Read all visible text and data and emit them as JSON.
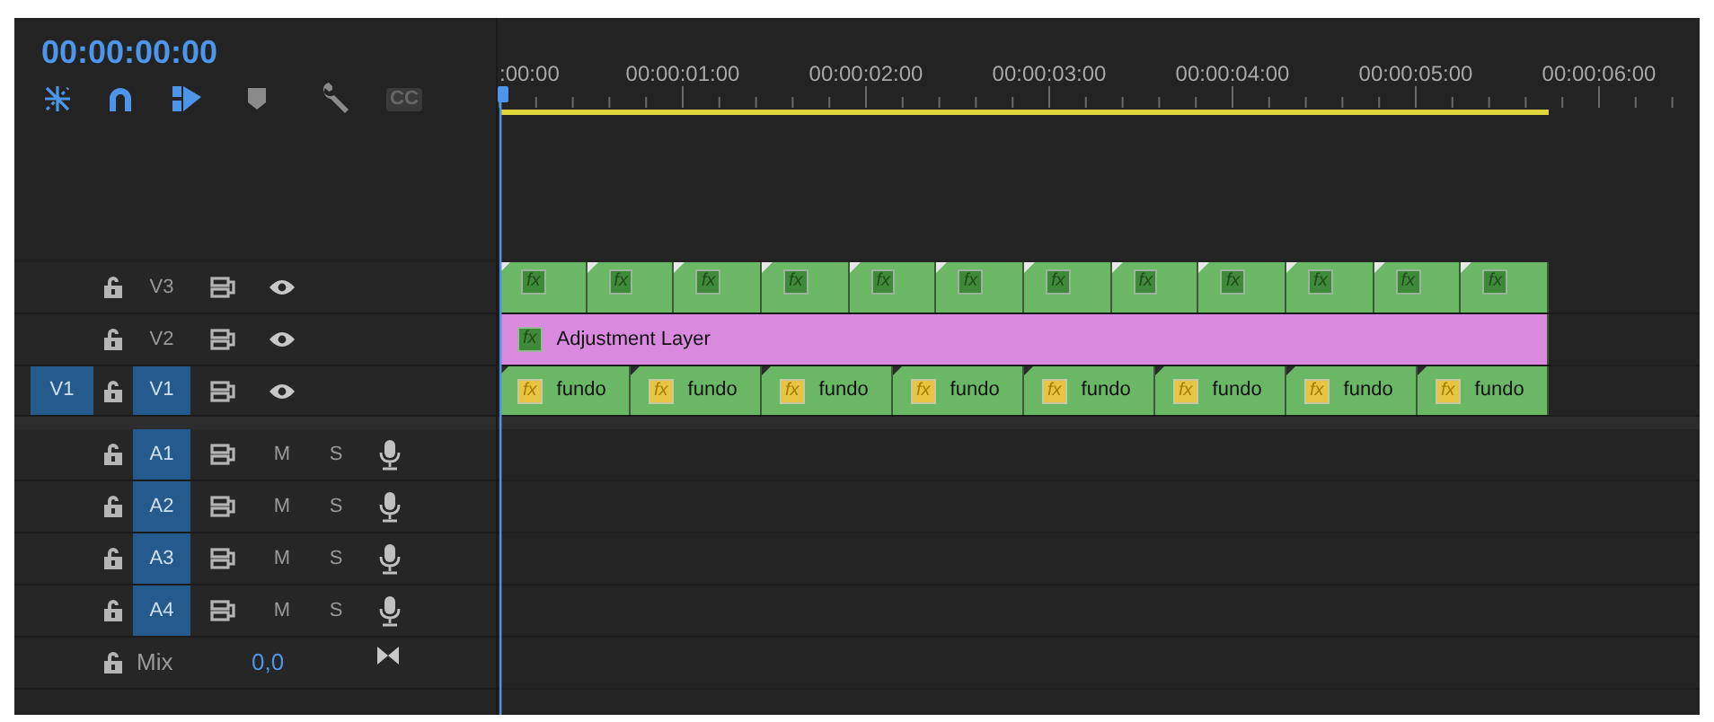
{
  "timecode": "00:00:00:00",
  "toolbar": [
    {
      "kind": "nest",
      "on": true
    },
    {
      "kind": "snap",
      "on": true
    },
    {
      "kind": "linked",
      "on": true
    },
    {
      "kind": "marker",
      "on": false
    },
    {
      "kind": "settings",
      "on": false
    },
    {
      "kind": "captions",
      "on": false,
      "label": "CC"
    }
  ],
  "ruler": {
    "labels": [
      ":00:00",
      "00:00:01:00",
      "00:00:02:00",
      "00:00:03:00",
      "00:00:04:00",
      "00:00:05:00",
      "00:00:06:00"
    ]
  },
  "video_tracks": [
    {
      "name": "V3",
      "targeted": false,
      "clips": [
        {
          "color": "#6ab866",
          "badge": {
            "text": "fx",
            "kind": "green"
          }
        },
        {
          "color": "#6ab866",
          "badge": {
            "text": "fx",
            "kind": "green"
          }
        },
        {
          "color": "#6ab866",
          "badge": {
            "text": "fx",
            "kind": "green"
          }
        },
        {
          "color": "#6ab866",
          "badge": {
            "text": "fx",
            "kind": "green"
          }
        },
        {
          "color": "#6ab866",
          "badge": {
            "text": "fx",
            "kind": "green"
          }
        },
        {
          "color": "#6ab866",
          "badge": {
            "text": "fx",
            "kind": "green"
          }
        },
        {
          "color": "#6ab866",
          "badge": {
            "text": "fx",
            "kind": "green"
          }
        },
        {
          "color": "#6ab866",
          "badge": {
            "text": "fx",
            "kind": "green"
          }
        },
        {
          "color": "#6ab866",
          "badge": {
            "text": "fx",
            "kind": "green"
          }
        },
        {
          "color": "#6ab866",
          "badge": {
            "text": "fx",
            "kind": "green"
          }
        },
        {
          "color": "#6ab866",
          "badge": {
            "text": "fx",
            "kind": "green"
          }
        },
        {
          "color": "#6ab866",
          "badge": {
            "text": "fx",
            "kind": "green"
          }
        }
      ]
    },
    {
      "name": "V2",
      "targeted": false,
      "clips": [
        {
          "color": "#d98ade",
          "badge": {
            "text": "fx",
            "kind": "green"
          },
          "label": "Adjustment Layer"
        }
      ]
    },
    {
      "name": "V1",
      "targeted": true,
      "source_patch": "V1",
      "clips": [
        {
          "color": "#6ab866",
          "badge": {
            "text": "fx",
            "kind": "yellow"
          },
          "label": "fundo"
        },
        {
          "color": "#6ab866",
          "badge": {
            "text": "fx",
            "kind": "yellow"
          },
          "label": "fundo"
        },
        {
          "color": "#6ab866",
          "badge": {
            "text": "fx",
            "kind": "yellow"
          },
          "label": "fundo"
        },
        {
          "color": "#6ab866",
          "badge": {
            "text": "fx",
            "kind": "yellow"
          },
          "label": "fundo"
        },
        {
          "color": "#6ab866",
          "badge": {
            "text": "fx",
            "kind": "yellow"
          },
          "label": "fundo"
        },
        {
          "color": "#6ab866",
          "badge": {
            "text": "fx",
            "kind": "yellow"
          },
          "label": "fundo"
        },
        {
          "color": "#6ab866",
          "badge": {
            "text": "fx",
            "kind": "yellow"
          },
          "label": "fundo"
        },
        {
          "color": "#6ab866",
          "badge": {
            "text": "fx",
            "kind": "yellow"
          },
          "label": "fundo"
        }
      ]
    }
  ],
  "audio_tracks": [
    {
      "name": "A1",
      "targeted": true,
      "mute_label": "M",
      "solo_label": "S"
    },
    {
      "name": "A2",
      "targeted": true,
      "mute_label": "M",
      "solo_label": "S"
    },
    {
      "name": "A3",
      "targeted": true,
      "mute_label": "M",
      "solo_label": "S"
    },
    {
      "name": "A4",
      "targeted": true,
      "mute_label": "M",
      "solo_label": "S"
    }
  ],
  "mix": {
    "label": "Mix",
    "value": "0,0"
  }
}
